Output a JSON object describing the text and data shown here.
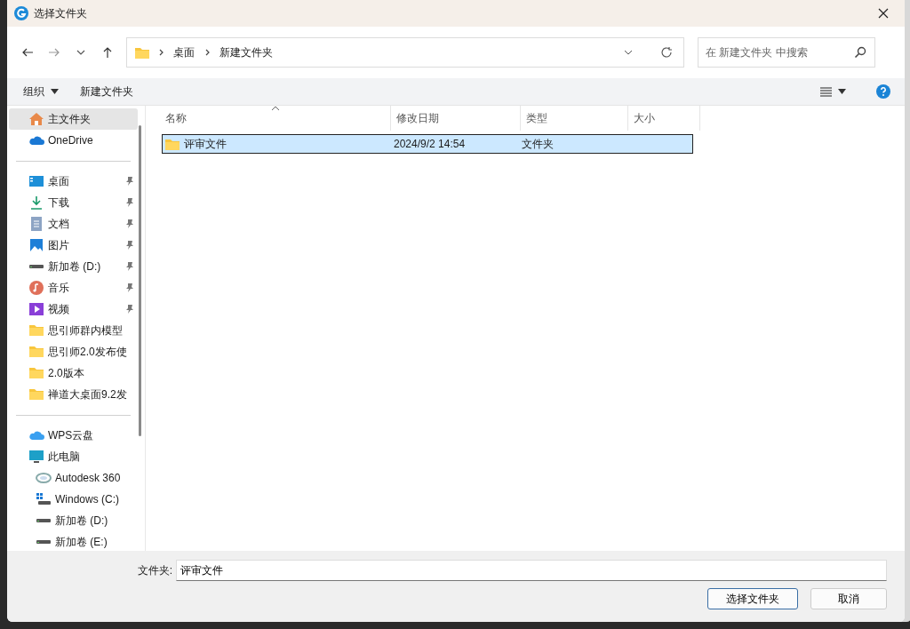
{
  "window": {
    "title": "选择文件夹"
  },
  "nav": {
    "path": [
      "桌面",
      "新建文件夹"
    ],
    "search": {
      "placeholder": "在 新建文件夹 中搜索"
    }
  },
  "toolbar": {
    "organize": "组织",
    "new_folder": "新建文件夹"
  },
  "sidebar": {
    "sections": [
      [
        {
          "label": "主文件夹",
          "kind": "home",
          "selected": true,
          "pinned": false
        },
        {
          "label": "OneDrive",
          "kind": "onedrive",
          "selected": false,
          "pinned": false
        }
      ],
      [
        {
          "label": "桌面",
          "kind": "desktop",
          "selected": false,
          "pinned": true
        },
        {
          "label": "下载",
          "kind": "download",
          "selected": false,
          "pinned": true
        },
        {
          "label": "文档",
          "kind": "document",
          "selected": false,
          "pinned": true
        },
        {
          "label": "图片",
          "kind": "picture",
          "selected": false,
          "pinned": true
        },
        {
          "label": "新加卷 (D:)",
          "kind": "drive",
          "selected": false,
          "pinned": true
        },
        {
          "label": "音乐",
          "kind": "music",
          "selected": false,
          "pinned": true
        },
        {
          "label": "视频",
          "kind": "video",
          "selected": false,
          "pinned": true
        },
        {
          "label": "思引师群内模型",
          "kind": "folder",
          "selected": false,
          "pinned": false
        },
        {
          "label": "思引师2.0发布使",
          "kind": "folder",
          "selected": false,
          "pinned": false
        },
        {
          "label": "2.0版本",
          "kind": "folder",
          "selected": false,
          "pinned": false
        },
        {
          "label": "禅道大桌面9.2发",
          "kind": "folder",
          "selected": false,
          "pinned": false
        }
      ],
      [
        {
          "label": "WPS云盘",
          "kind": "cloud",
          "selected": false,
          "pinned": false
        },
        {
          "label": "此电脑",
          "kind": "pc",
          "selected": false,
          "pinned": false,
          "children": [
            {
              "label": "Autodesk 360",
              "kind": "network",
              "selected": false,
              "pinned": false
            },
            {
              "label": "Windows (C:)",
              "kind": "windows",
              "selected": false,
              "pinned": false
            },
            {
              "label": "新加卷 (D:)",
              "kind": "drive",
              "selected": false,
              "pinned": false
            },
            {
              "label": "新加卷 (E:)",
              "kind": "drive",
              "selected": false,
              "pinned": false
            }
          ]
        }
      ]
    ]
  },
  "table": {
    "columns": [
      "名称",
      "修改日期",
      "类型",
      "大小"
    ],
    "rows": [
      {
        "name": "评审文件",
        "modified": "2024/9/2 14:54",
        "type": "文件夹",
        "selected": true
      }
    ]
  },
  "footer": {
    "label": "文件夹:",
    "value": "评审文件",
    "buttons": [
      "选择文件夹",
      "取消"
    ]
  }
}
